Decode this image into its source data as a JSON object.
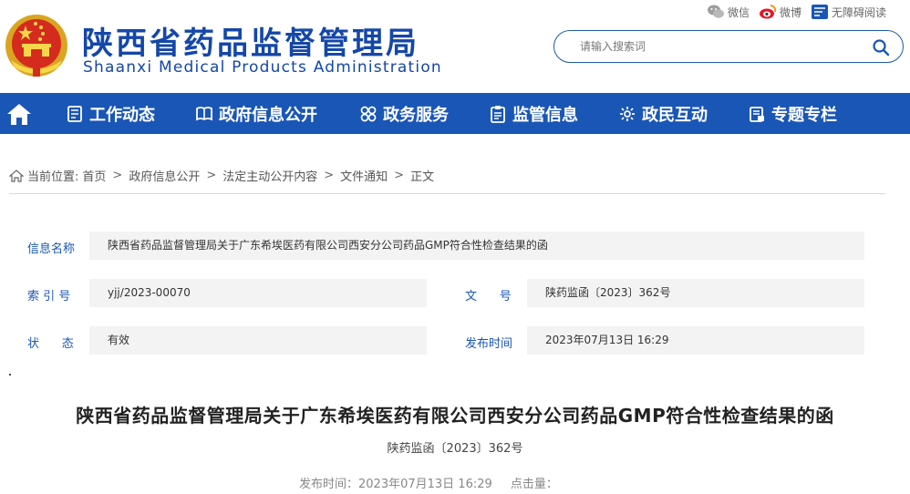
{
  "header": {
    "title_cn": "陕西省药品监督管理局",
    "title_en": "Shaanxi Medical Products Administration",
    "links": {
      "wechat": "微信",
      "weibo": "微博",
      "accessibility": "无障碍阅读"
    },
    "search": {
      "placeholder": "请输入搜索词"
    }
  },
  "nav": {
    "items": [
      {
        "label": "工作动态",
        "icon": "list-icon"
      },
      {
        "label": "政府信息公开",
        "icon": "book-icon"
      },
      {
        "label": "政务服务",
        "icon": "grid-icon"
      },
      {
        "label": "监管信息",
        "icon": "clipboard-icon"
      },
      {
        "label": "政民互动",
        "icon": "chat-icon"
      },
      {
        "label": "专题专栏",
        "icon": "folder-icon"
      }
    ]
  },
  "breadcrumb": {
    "prefix": "当前位置:",
    "items": [
      "首页",
      "政府信息公开",
      "法定主动公开内容",
      "文件通知",
      "正文"
    ]
  },
  "info": {
    "name_label": "信息名称",
    "name_value": "陕西省药品监督管理局关于广东希埃医药有限公司西安分公司药品GMP符合性检查结果的函",
    "index_label": "索 引 号",
    "index_value": "yjj/2023-00070",
    "docno_label": "文      号",
    "docno_value": "陕药监函〔2023〕362号",
    "status_label": "状      态",
    "status_value": "有效",
    "date_label": "发布时间",
    "date_value": "2023年07月13日 16:29"
  },
  "article": {
    "title": "陕西省药品监督管理局关于广东希埃医药有限公司西安分公司药品GMP符合性检查结果的函",
    "doc_number": "陕药监函〔2023〕362号",
    "publish_time": "发布时间：2023年07月13日 16:29",
    "views_label": "点击量："
  },
  "colors": {
    "brand_blue": "#1a56b6",
    "cell_bg": "#f3f3f3"
  }
}
